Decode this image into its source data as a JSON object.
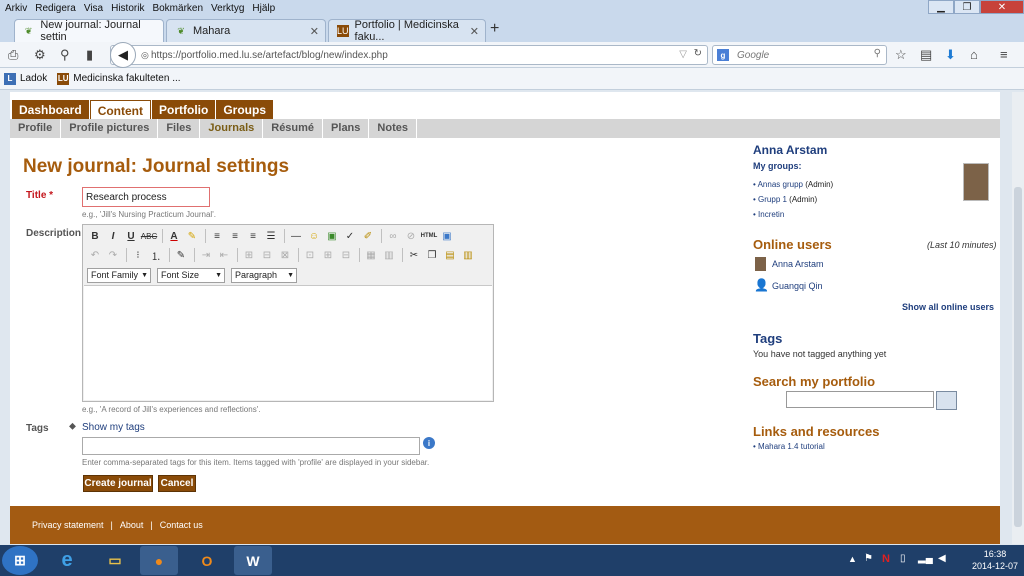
{
  "menubar": {
    "items": [
      "Arkiv",
      "Redigera",
      "Visa",
      "Historik",
      "Bokmärken",
      "Verktyg",
      "Hjälp"
    ]
  },
  "window": {
    "minimize": "▁",
    "maximize": "❐",
    "close": "✕"
  },
  "tabs": [
    {
      "label": "New journal: Journal settin",
      "active": true
    },
    {
      "label": "Mahara",
      "active": false
    },
    {
      "label": "Portfolio | Medicinska faku...",
      "active": false
    }
  ],
  "nav": {
    "url": "https://portfolio.med.lu.se/artefact/blog/new/index.php",
    "search_placeholder": "Google",
    "search_engine_icon": "g"
  },
  "bookmarks": [
    {
      "label": "Ladok",
      "icon": "LU-logo"
    },
    {
      "label": "Medicinska fakulteten ...",
      "icon": "LU-logo"
    }
  ],
  "site": {
    "main_tabs": [
      "Dashboard",
      "Content",
      "Portfolio",
      "Groups"
    ],
    "selected_main_tab": "Content",
    "sub_tabs": [
      "Profile",
      "Profile pictures",
      "Files",
      "Journals",
      "Résumé",
      "Plans",
      "Notes"
    ],
    "selected_sub_tab": "Journals"
  },
  "form": {
    "heading": "New journal: Journal settings",
    "title_label": "Title",
    "required_mark": "*",
    "title_value": "Research process",
    "title_hint": "e.g., 'Jill's Nursing Practicum Journal'.",
    "description_label": "Description",
    "description_hint": "e.g., 'A record of Jill's experiences and reflections'.",
    "editor": {
      "font_family": "Font Family",
      "font_size": "Font Size",
      "format": "Paragraph",
      "html_button": "HTML"
    },
    "tags_label": "Tags",
    "show_tags": "Show my tags",
    "tags_hint": "Enter comma-separated tags for this item. Items tagged with 'profile' are displayed in your sidebar.",
    "create_button": "Create journal",
    "cancel_button": "Cancel"
  },
  "sidebar": {
    "user_name": "Anna Arstam",
    "my_groups_label": "My groups:",
    "groups": [
      {
        "name": "Annas grupp",
        "role": "(Admin)"
      },
      {
        "name": "Grupp 1",
        "role": "(Admin)"
      },
      {
        "name": "Incretin",
        "role": ""
      }
    ],
    "online_heading": "Online users",
    "online_note": "(Last 10 minutes)",
    "online_users": [
      "Anna Arstam",
      "Guangqi Qin"
    ],
    "show_all_online": "Show all online users",
    "tags_heading": "Tags",
    "tags_note": "You have not tagged anything yet",
    "search_heading": "Search my portfolio",
    "links_heading": "Links and resources",
    "links": [
      "Mahara 1.4 tutorial"
    ]
  },
  "footer": {
    "links": [
      "Privacy statement",
      "About",
      "Contact us"
    ],
    "separator": "|"
  },
  "taskbar": {
    "time": "16:38",
    "date": "2014-12-07"
  },
  "colors": {
    "brand": "#8a4b08",
    "heading": "#a65c0d",
    "footer": "#a35b12",
    "link": "#1f3e7d"
  }
}
